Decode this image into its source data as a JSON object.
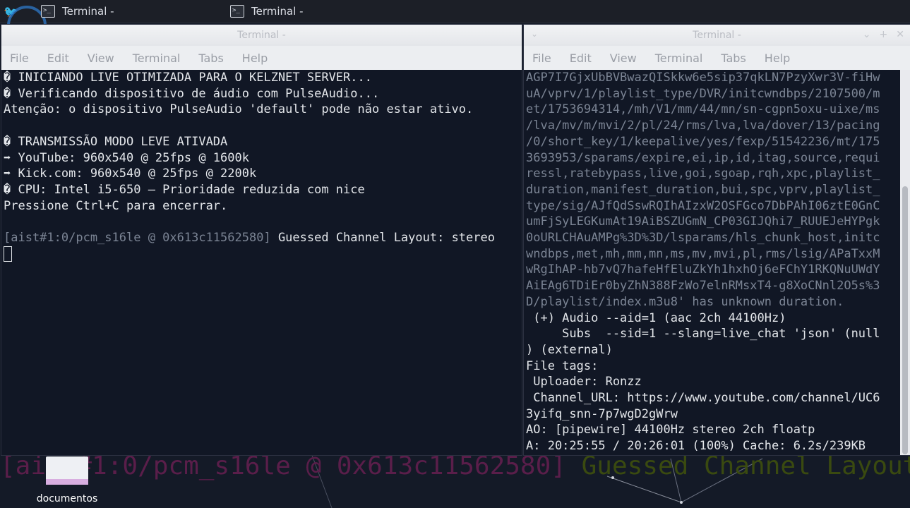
{
  "taskbar": {
    "tasks": [
      {
        "title": "Terminal -"
      },
      {
        "title": "Terminal -"
      }
    ]
  },
  "left_terminal": {
    "title": "Terminal -",
    "menu": [
      "File",
      "Edit",
      "View",
      "Terminal",
      "Tabs",
      "Help"
    ],
    "lines": [
      "� INICIANDO LIVE OTIMIZADA PARA O KELZNET SERVER...",
      "� Verificando dispositivo de áudio com PulseAudio...",
      "Atenção: o dispositivo PulseAudio 'default' pode não estar ativo.",
      "",
      "� TRANSMISSÃO MODO LEVE ATIVADA",
      "➡ YouTube: 960x540 @ 25fps @ 1600k",
      "➡ Kick.com: 960x540 @ 25fps @ 2200k",
      "� CPU: Intel i5-650 – Prioridade reduzida com nice",
      "Pressione Ctrl+C para encerrar.",
      ""
    ],
    "last_line_dim": "[aist#1:0/pcm_s16le @ 0x613c11562580]",
    "last_line_text": " Guessed Channel Layout: stereo"
  },
  "right_terminal": {
    "title": "Terminal -",
    "menu": [
      "File",
      "Edit",
      "View",
      "Terminal",
      "Tabs",
      "Help"
    ],
    "dim_lines": [
      "AGP7I7GjxUbBVBwazQISkkw6e5sip37qkLN7PzyXwr3V-fiHw",
      "uA/vprv/1/playlist_type/DVR/initcwndbps/2107500/m",
      "et/1753694314,/mh/V1/mm/44/mn/sn-cgpn5oxu-uixe/ms",
      "/lva/mv/m/mvi/2/pl/24/rms/lva,lva/dover/13/pacing",
      "/0/short_key/1/keepalive/yes/fexp/51542236/mt/175",
      "3693953/sparams/expire,ei,ip,id,itag,source,requi",
      "ressl,ratebypass,live,goi,sgoap,rqh,xpc,playlist_",
      "duration,manifest_duration,bui,spc,vprv,playlist_",
      "type/sig/AJfQdSswRQIhAIzxW2OSFGco7DbPAhI06ztE0GnC",
      "umFjSyLEGKumAt19AiBSZUGmN_CP03GIJQhi7_RUUEJeHYPgk",
      "0oURLCHAuAMPg%3D%3D/lsparams/hls_chunk_host,initc",
      "wndbps,met,mh,mm,mn,ms,mv,mvi,pl,rms/lsig/APaTxxM",
      "wRgIhAP-hb7vQ7hafeHfEluZkYh1hxhOj6eFChY1RKQNuUWdY",
      "AiEAg6TDiEr0byZhN388FzWo7elnRMsxT4-g8XoCNnl2O5s%3",
      "D/playlist/index.m3u8' has unknown duration."
    ],
    "lines": [
      " (+) Audio --aid=1 (aac 2ch 44100Hz)",
      "     Subs  --sid=1 --slang=live_chat 'json' (null",
      ") (external)",
      "File tags:",
      " Uploader: Ronzz",
      " Channel_URL: https://www.youtube.com/channel/UC6",
      "3yifq_snn-7p7wgD2gWrw",
      "AO: [pipewire] 44100Hz stereo 2ch floatp",
      "A: 20:25:55 / 20:26:01 (100%) Cache: 6.2s/239KB"
    ]
  },
  "desktop": {
    "icon_label": "documentos",
    "bg_ghost_dim": "[aist#1:0/pcm_s16le @ 0x613c11562580]",
    "bg_ghost_green": " Guessed Channel Layout"
  }
}
